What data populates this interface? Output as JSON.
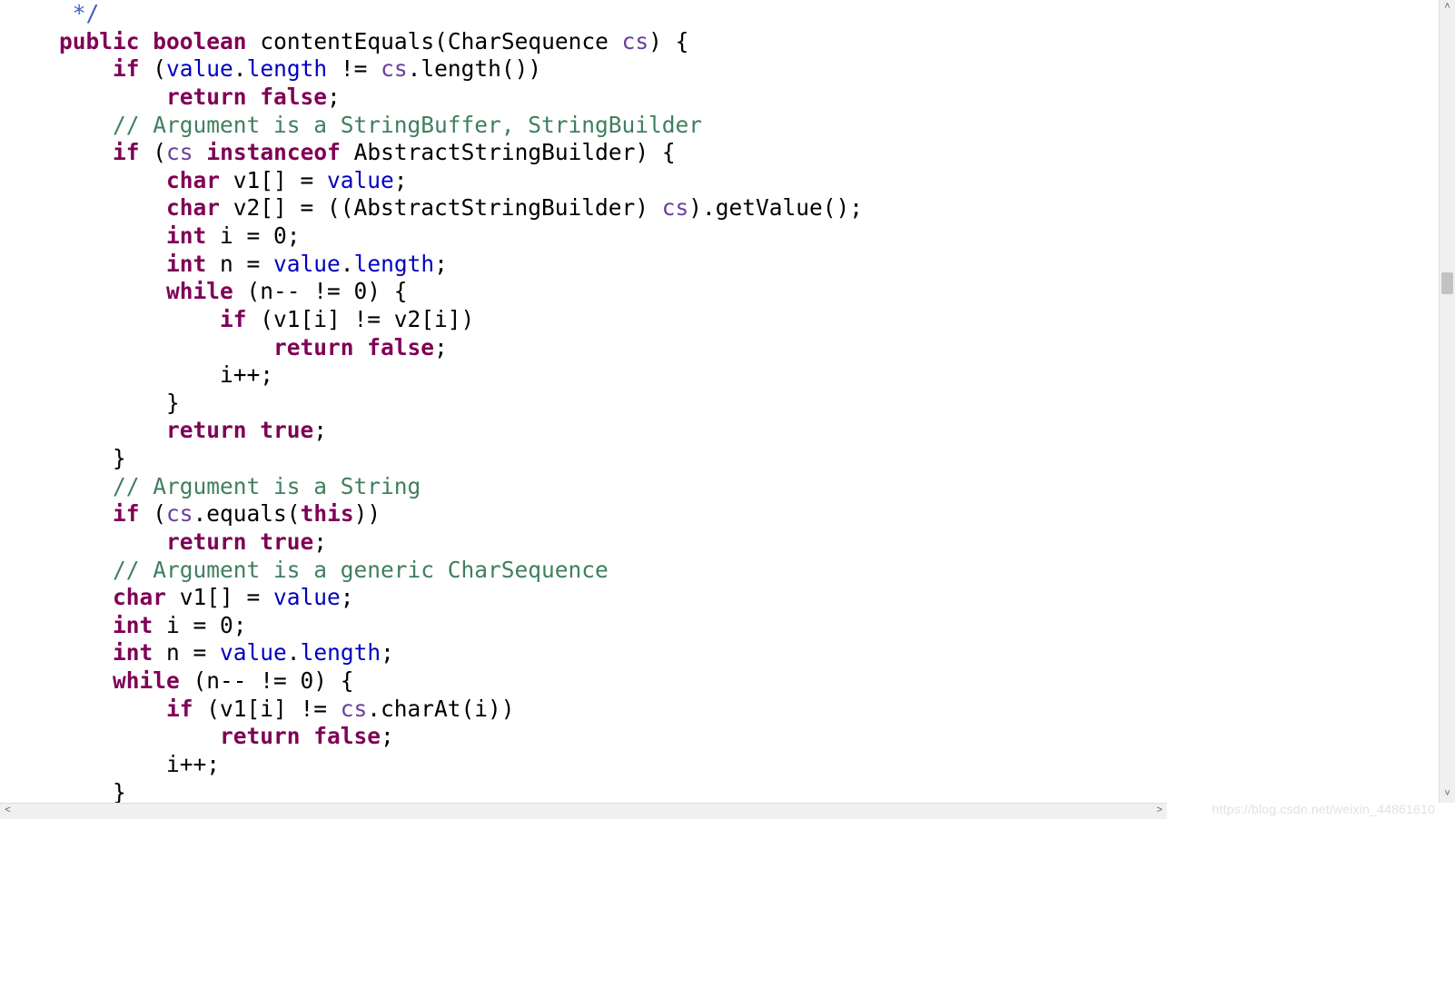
{
  "code": {
    "l1_jdc_close": "     */",
    "l2_sig_kw1": "    public",
    "l2_sig_kw2": "boolean",
    "l2_sig_name": "contentEquals(CharSequence ",
    "l2_sig_param": "cs",
    "l2_sig_tail": ") {",
    "l3_if": "        if",
    "l3_open": " (",
    "l3_value": "value",
    "l3_dot": ".",
    "l3_length": "length",
    "l3_mid": " != ",
    "l3_cs": "cs",
    "l3_tail": ".length())",
    "l4_ret": "            return",
    "l4_false": "false",
    "l4_semi": ";",
    "l5_com": "        // Argument is a StringBuffer, StringBuilder",
    "l6_if": "        if",
    "l6_open": " (",
    "l6_cs": "cs",
    "l6_sp": " ",
    "l6_inst": "instanceof",
    "l6_tail": " AbstractStringBuilder) {",
    "l7_char": "            char",
    "l7_v1decl": " v1[] = ",
    "l7_value": "value",
    "l7_semi": ";",
    "l8_char": "            char",
    "l8_v2decl": " v2[] = ((AbstractStringBuilder) ",
    "l8_cs": "cs",
    "l8_tail": ").getValue();",
    "l9_int": "            int",
    "l9_tail": " i = 0;",
    "l10_int": "            int",
    "l10_mid": " n = ",
    "l10_value": "value",
    "l10_dot": ".",
    "l10_length": "length",
    "l10_semi": ";",
    "l11_while": "            while",
    "l11_tail": " (n-- != 0) {",
    "l12_if": "                if",
    "l12_tail": " (v1[i] != v2[i])",
    "l13_ret": "                    return",
    "l13_false": "false",
    "l13_semi": ";",
    "l14": "                i++;",
    "l15": "            }",
    "l16_ret": "            return",
    "l16_true": "true",
    "l16_semi": ";",
    "l17": "        }",
    "l18_com": "        // Argument is a String",
    "l19_if": "        if",
    "l19_open": " (",
    "l19_cs": "cs",
    "l19_mid": ".equals(",
    "l19_this": "this",
    "l19_tail": "))",
    "l20_ret": "            return",
    "l20_true": "true",
    "l20_semi": ";",
    "l21_com": "        // Argument is a generic CharSequence",
    "l22_char": "        char",
    "l22_mid": " v1[] = ",
    "l22_value": "value",
    "l22_semi": ";",
    "l23_int": "        int",
    "l23_tail": " i = 0;",
    "l24_int": "        int",
    "l24_mid": " n = ",
    "l24_value": "value",
    "l24_dot": ".",
    "l24_length": "length",
    "l24_semi": ";",
    "l25_while": "        while",
    "l25_tail": " (n-- != 0) {",
    "l26_if": "            if",
    "l26_mid": " (v1[i] != ",
    "l26_cs": "cs",
    "l26_tail": ".charAt(i))",
    "l27_ret": "                return",
    "l27_false": "false",
    "l27_semi": ";",
    "l28": "            i++;",
    "l29": "        }"
  },
  "scroll": {
    "up": "˄",
    "down": "˅",
    "left": "˂",
    "right": "˃"
  },
  "watermark": "https://blog.csdn.net/weixin_44861610"
}
